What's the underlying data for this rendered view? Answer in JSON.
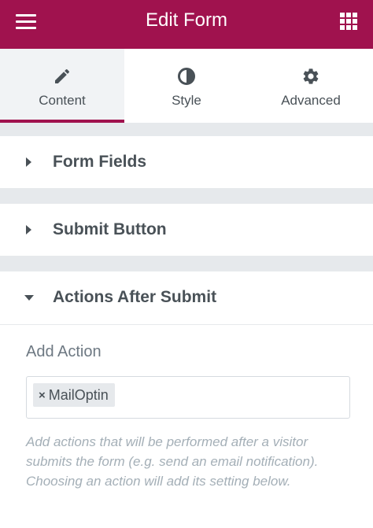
{
  "header": {
    "title": "Edit Form",
    "menu_icon": "hamburger-icon",
    "apps_icon": "grid-icon",
    "background": "#a0124e"
  },
  "tabs": [
    {
      "label": "Content",
      "icon": "pencil-icon",
      "active": true
    },
    {
      "label": "Style",
      "icon": "half-circle-icon",
      "active": false
    },
    {
      "label": "Advanced",
      "icon": "gear-icon",
      "active": false
    }
  ],
  "sections": [
    {
      "title": "Form Fields",
      "expanded": false
    },
    {
      "title": "Submit Button",
      "expanded": false
    },
    {
      "title": "Actions After Submit",
      "expanded": true
    }
  ],
  "actions": {
    "label": "Add Action",
    "selected": [
      {
        "remove": "×",
        "label": "MailOptin"
      }
    ],
    "help": "Add actions that will be performed after a visitor submits the form (e.g. send an email notification). Choosing an action will add its setting below."
  },
  "colors": {
    "accent": "#a0124e",
    "text": "#495157",
    "muted": "#a4afb7",
    "separator": "#e6e9ec"
  }
}
